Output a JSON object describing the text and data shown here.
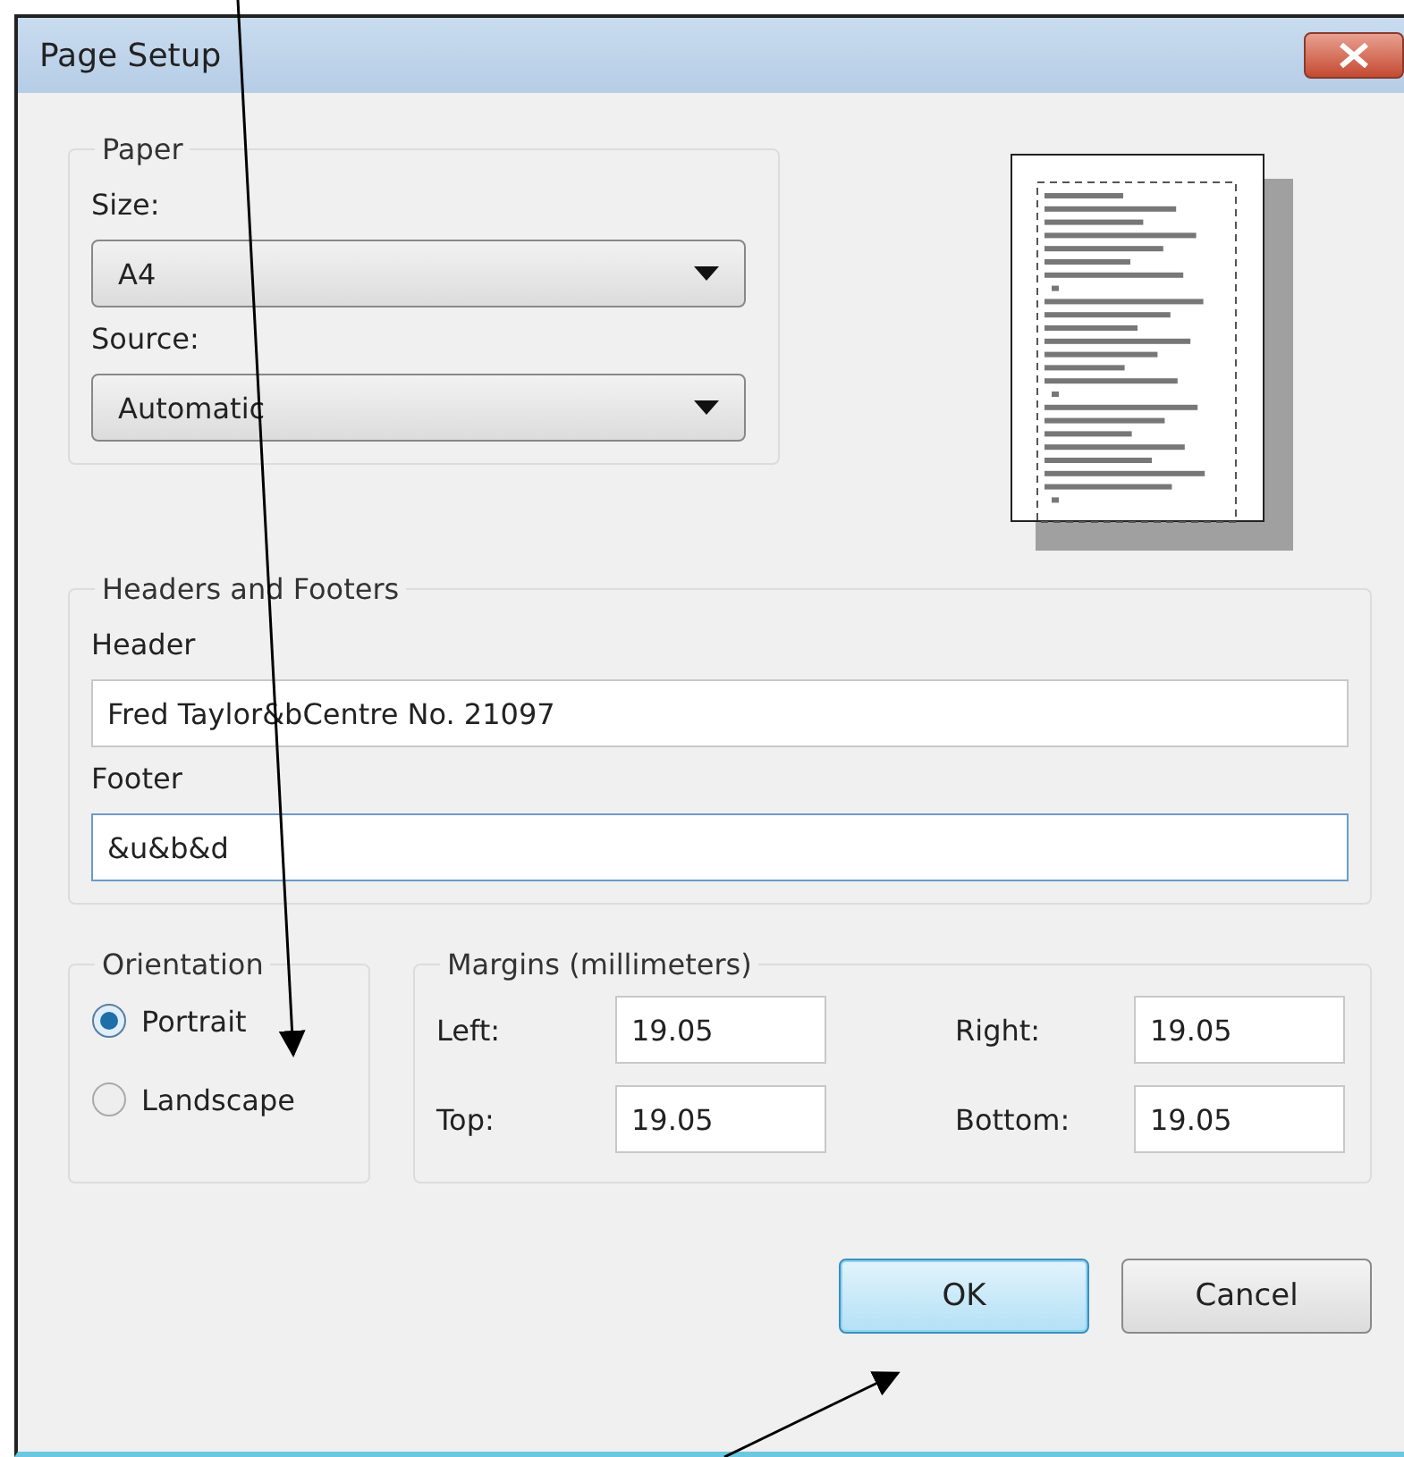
{
  "window": {
    "title": "Page Setup"
  },
  "paper": {
    "legend": "Paper",
    "size_label": "Size:",
    "size_value": "A4",
    "source_label": "Source:",
    "source_value": "Automatic"
  },
  "headers_footers": {
    "legend": "Headers and Footers",
    "fields": [
      {
        "label": "Header",
        "value": "Fred Taylor&bCentre No. 21097",
        "focused": false
      },
      {
        "label": "Footer",
        "value": "&u&b&d",
        "focused": true
      }
    ]
  },
  "orientation": {
    "legend": "Orientation",
    "options": [
      {
        "label": "Portrait",
        "selected": true
      },
      {
        "label": "Landscape",
        "selected": false
      }
    ]
  },
  "margins": {
    "legend": "Margins (millimeters)",
    "fields": [
      {
        "label": "Left:",
        "value": "19.05"
      },
      {
        "label": "Right:",
        "value": "19.05"
      },
      {
        "label": "Top:",
        "value": "19.05"
      },
      {
        "label": "Bottom:",
        "value": "19.05"
      }
    ]
  },
  "buttons": [
    {
      "label": "OK",
      "default": true
    },
    {
      "label": "Cancel",
      "default": false
    }
  ]
}
